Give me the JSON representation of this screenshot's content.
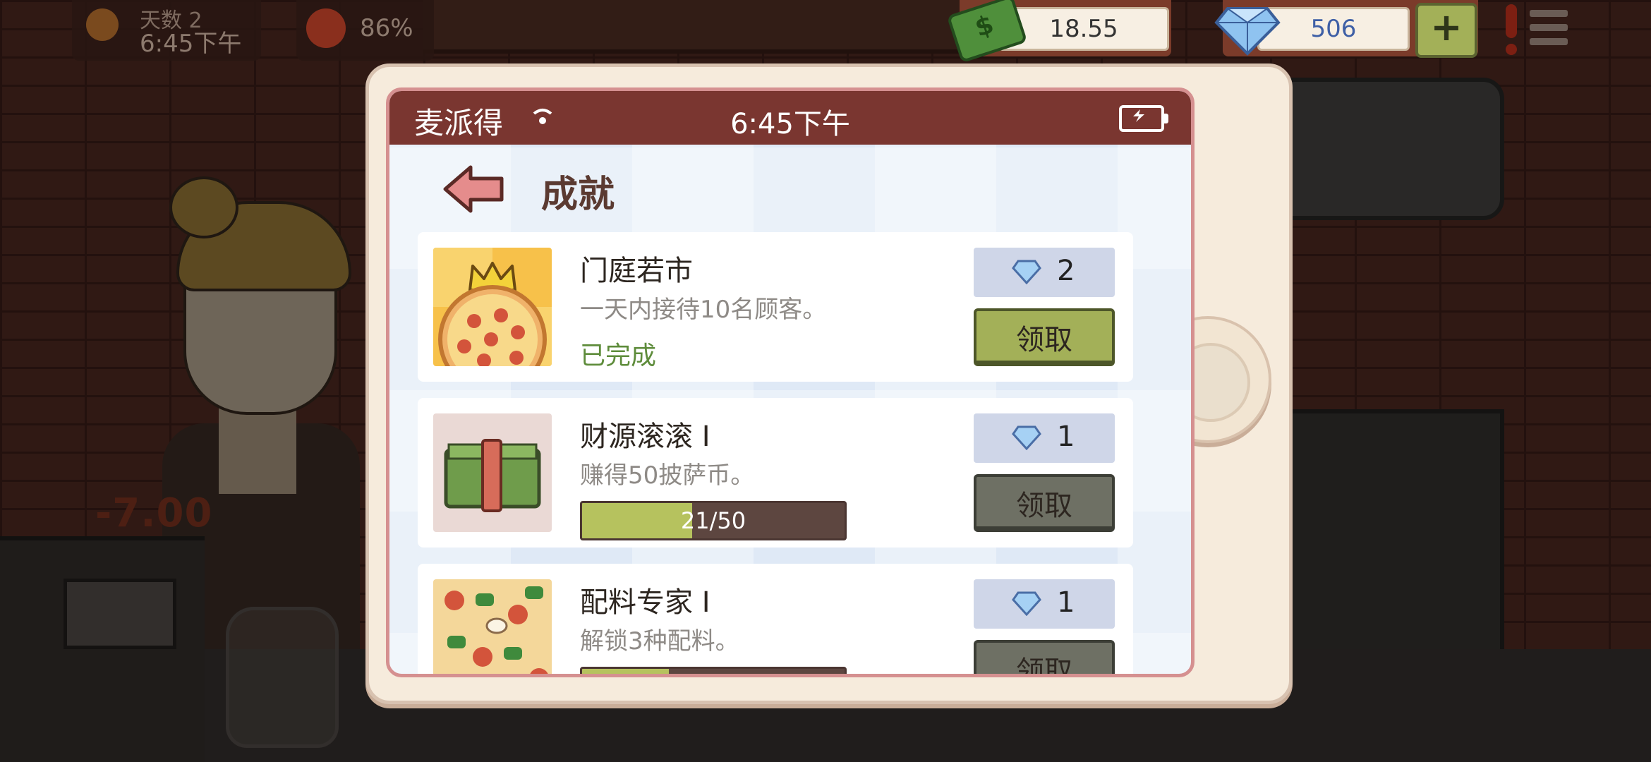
{
  "hud": {
    "day_label": "天数  2",
    "time": "6:45下午",
    "mood_percent": "86%",
    "cash": "18.55",
    "gems": "506",
    "plus_label": "+"
  },
  "scene": {
    "money_change": "-7.00"
  },
  "phone": {
    "app_name": "麦派得",
    "time": "6:45下午",
    "page_title": "成就"
  },
  "achievements": [
    {
      "title": "门庭若市",
      "desc": "一天内接待10名顾客。",
      "status": "已完成",
      "reward": "2",
      "claim_label": "领取",
      "completed": true
    },
    {
      "title": "财源滚滚 I",
      "desc": "赚得50披萨币。",
      "progress_label": "21/50",
      "progress": 0.42,
      "reward": "1",
      "claim_label": "领取",
      "completed": false
    },
    {
      "title": "配料专家 I",
      "desc": "解锁3种配料。",
      "progress": 0.33,
      "reward": "1",
      "claim_label": "领取",
      "completed": false
    }
  ],
  "colors": {
    "statusbar": "#7a3630",
    "claim_active": "#a3b058",
    "claim_disabled": "#6e7064",
    "completed_text": "#5e8c3b"
  }
}
